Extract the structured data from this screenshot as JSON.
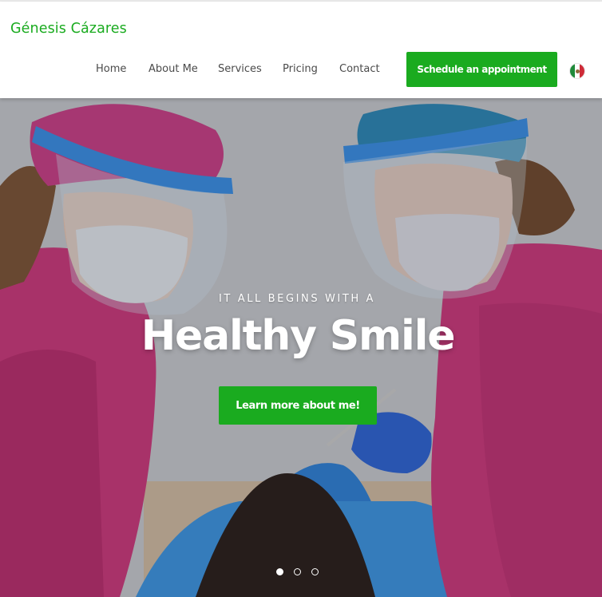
{
  "brand": {
    "name": "Génesis Cázares",
    "color": "#1aab1f"
  },
  "nav": {
    "items": [
      {
        "label": "Home"
      },
      {
        "label": "About Me"
      },
      {
        "label": "Services"
      },
      {
        "label": "Pricing"
      },
      {
        "label": "Contact"
      }
    ],
    "cta_label": "Schedule an appointment",
    "language_flag": "mexico-flag-icon"
  },
  "hero": {
    "kicker": "IT ALL BEGINS WITH A",
    "title": "Healthy Smile",
    "button_label": "Learn more about me!",
    "image": "dentists-treating-patient-photo",
    "slides": {
      "count": 3,
      "active": 1
    }
  },
  "colors": {
    "accent": "#1aab1f",
    "text": "#4a4a4a",
    "hero_text": "#ffffff"
  }
}
